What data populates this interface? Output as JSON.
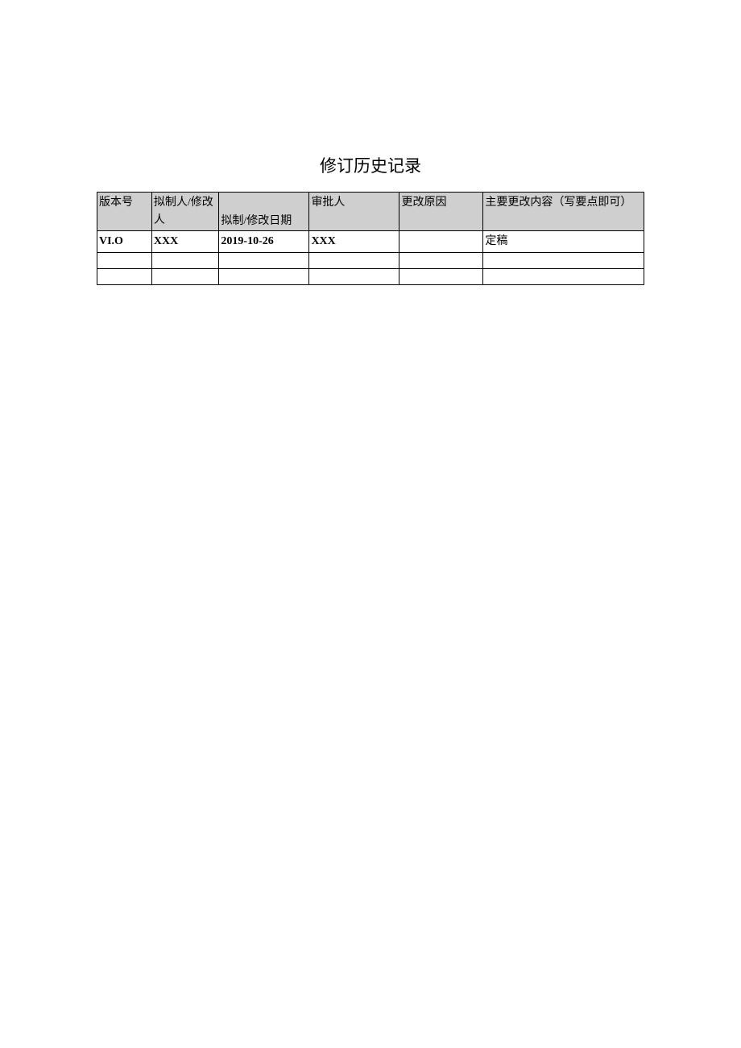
{
  "title": "修订历史记录",
  "headers": {
    "col1": "版本号",
    "col2": "拟制人/修改人",
    "col3": "拟制/修改日期",
    "col4": "审批人",
    "col5": "更改原因",
    "col6": "主要更改内容（写要点即可）"
  },
  "rows": [
    {
      "version": "VI.O",
      "author": "XXX",
      "date": "2019-10-26",
      "approver": "XXX",
      "reason": "",
      "content": "定稿"
    },
    {
      "version": "",
      "author": "",
      "date": "",
      "approver": "",
      "reason": "",
      "content": ""
    },
    {
      "version": "",
      "author": "",
      "date": "",
      "approver": "",
      "reason": "",
      "content": ""
    }
  ]
}
